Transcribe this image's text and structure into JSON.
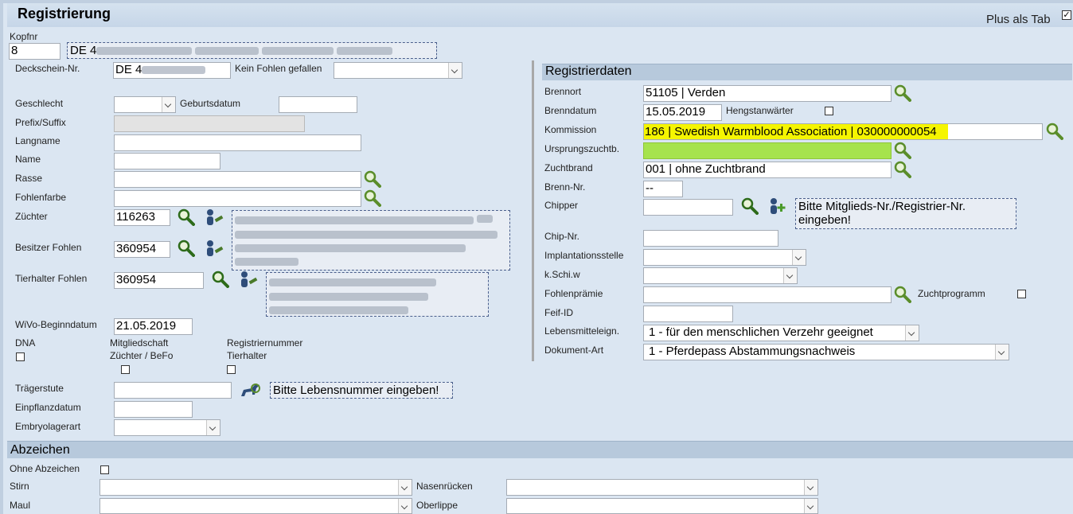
{
  "title": "Registrierung",
  "plus_als_tab": {
    "label": "Plus als Tab",
    "checked": true
  },
  "kopf": {
    "label": "Kopfnr",
    "value": "8",
    "lebensnummer_prefix": "DE 4"
  },
  "left": {
    "deckschein_label": "Deckschein-Nr.",
    "deckschein_value": "DE 4",
    "kein_fohlen_label": "Kein Fohlen gefallen",
    "geschlecht_label": "Geschlecht",
    "geburtsdatum_label": "Geburtsdatum",
    "prefix_label": "Prefix/Suffix",
    "langname_label": "Langname",
    "name_label": "Name",
    "rasse_label": "Rasse",
    "fohlenfarbe_label": "Fohlenfarbe",
    "zuechter_label": "Züchter",
    "zuechter_value": "116263",
    "besitzer_label": "Besitzer Fohlen",
    "besitzer_value": "360954",
    "tierhalter_label": "Tierhalter Fohlen",
    "tierhalter_value": "360954",
    "wivo_label": "WiVo-Beginndatum",
    "wivo_value": "21.05.2019",
    "dna_label": "DNA",
    "mitglied_label1": "Mitgliedschaft",
    "mitglied_label2": "Züchter / BeFo",
    "regnr_label1": "Registriernummer",
    "regnr_label2": "Tierhalter",
    "traegerstute_label": "Trägerstute",
    "traeger_hint": "Bitte Lebensnummer eingeben!",
    "einpflanz_label": "Einpflanzdatum",
    "embryo_label": "Embryolagerart"
  },
  "right": {
    "section_title": "Registrierdaten",
    "brennort_label": "Brennort",
    "brennort_value": "51105 | Verden",
    "brenndatum_label": "Brenndatum",
    "brenndatum_value": "15.05.2019",
    "hengst_label": "Hengstanwärter",
    "kommission_label": "Kommission",
    "kommission_value": "186 | Swedish Warmblood Association | 030000000054",
    "ursprung_label": "Ursprungszuchtb.",
    "zuchtbrand_label": "Zuchtbrand",
    "zuchtbrand_value": "001 | ohne Zuchtbrand",
    "brennnr_label": "Brenn-Nr.",
    "brennnr_value": "--",
    "chipper_label": "Chipper",
    "chipper_hint": "Bitte Mitglieds-Nr./Registrier-Nr. eingeben!",
    "chipnr_label": "Chip-Nr.",
    "implant_label": "Implantationsstelle",
    "kschi_label": "k.Schi.w",
    "fohlenpraemie_label": "Fohlenprämie",
    "zuchtprogramm_label": "Zuchtprogramm",
    "feif_label": "Feif-ID",
    "lebensmittel_label": "Lebensmitteleign.",
    "lebensmittel_value": "1 - für den menschlichen Verzehr geeignet",
    "dokument_label": "Dokument-Art",
    "dokument_value": "1 - Pferdepass Abstammungsnachweis",
    "highlight_color": "#f5f500",
    "ursprung_fill": "#a6e34d"
  },
  "abzeichen": {
    "section_title": "Abzeichen",
    "ohne_label": "Ohne Abzeichen",
    "stirn_label": "Stirn",
    "nasen_label": "Nasenrücken",
    "maul_label": "Maul",
    "oberlippe_label": "Oberlippe"
  }
}
